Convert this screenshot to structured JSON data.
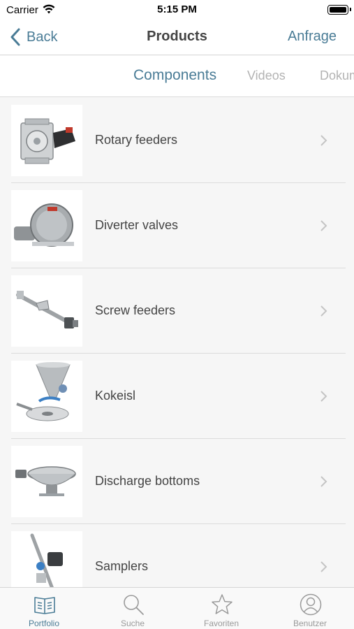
{
  "status_bar": {
    "carrier": "Carrier",
    "time": "5:15 PM"
  },
  "nav": {
    "back_label": "Back",
    "title": "Products",
    "right_label": "Anfrage"
  },
  "tabs": [
    {
      "label": "Components",
      "active": true
    },
    {
      "label": "Videos",
      "active": false
    },
    {
      "label": "Dokumente",
      "active": false
    }
  ],
  "products": [
    {
      "label": "Rotary feeders",
      "icon": "rotary-feeder-thumbnail"
    },
    {
      "label": "Diverter valves",
      "icon": "diverter-valve-thumbnail"
    },
    {
      "label": "Screw feeders",
      "icon": "screw-feeder-thumbnail"
    },
    {
      "label": "Kokeisl",
      "icon": "kokeisl-thumbnail"
    },
    {
      "label": "Discharge bottoms",
      "icon": "discharge-bottom-thumbnail"
    },
    {
      "label": "Samplers",
      "icon": "sampler-thumbnail"
    }
  ],
  "tab_bar": [
    {
      "label": "Portfolio",
      "icon": "book-icon",
      "active": true
    },
    {
      "label": "Suche",
      "icon": "search-icon",
      "active": false
    },
    {
      "label": "Favoriten",
      "icon": "star-icon",
      "active": false
    },
    {
      "label": "Benutzer",
      "icon": "user-icon",
      "active": false
    }
  ],
  "colors": {
    "accent": "#4a7c96",
    "inactive": "#9a9a9a",
    "background": "#f6f6f6"
  }
}
